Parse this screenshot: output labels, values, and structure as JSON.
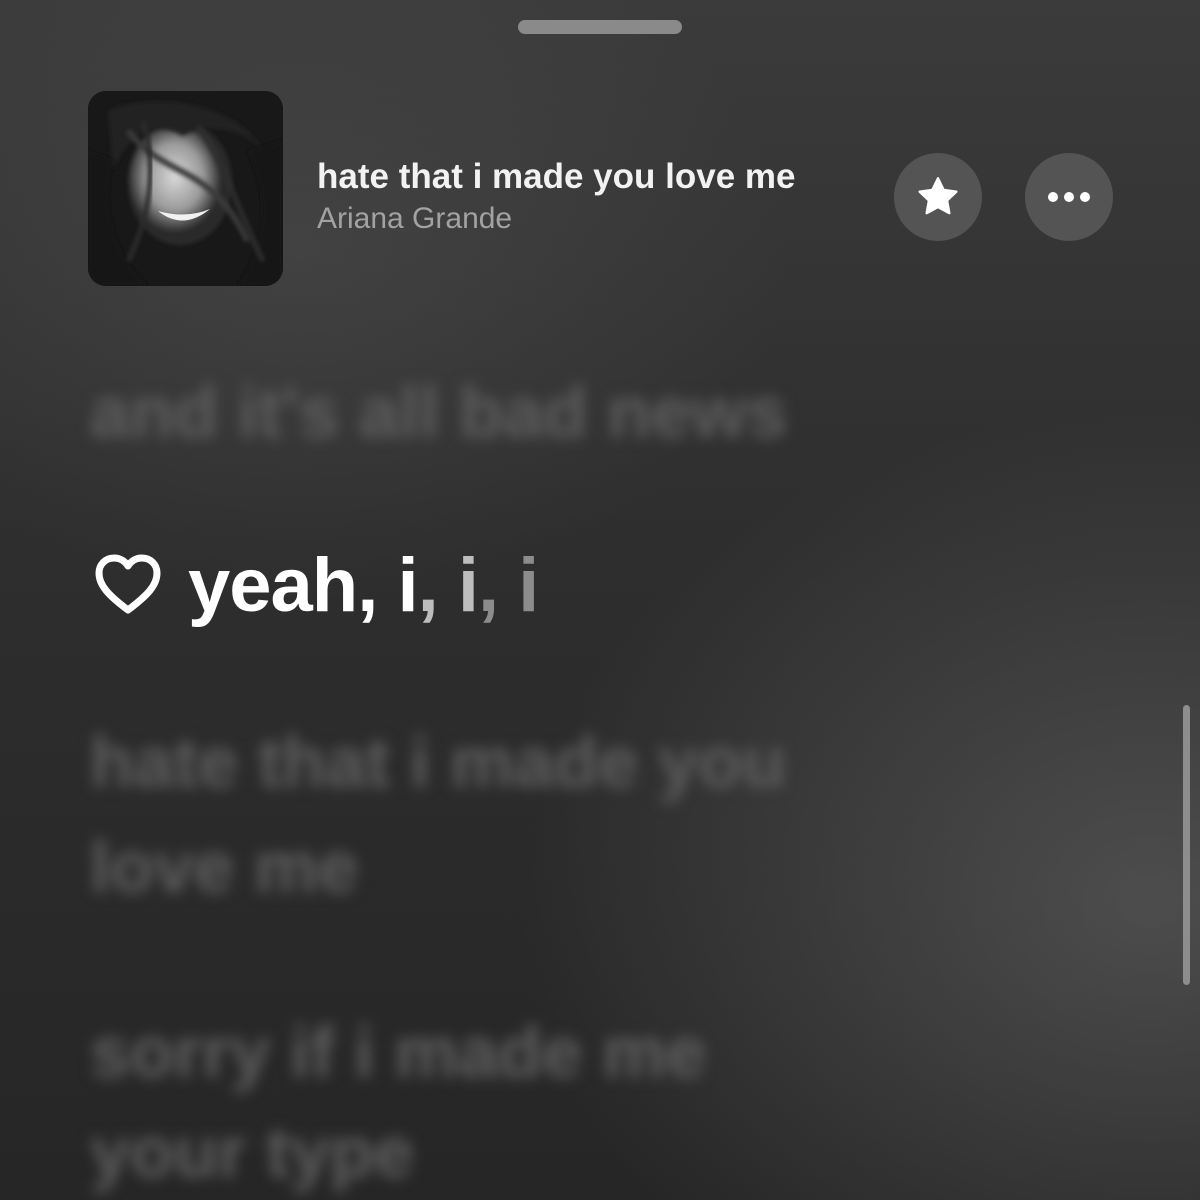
{
  "now_playing": {
    "title": "hate that i made you love me",
    "artist": "Ariana Grande"
  },
  "actions": {
    "favorite_icon": "star-icon",
    "more_icon": "ellipsis-icon"
  },
  "lyrics": {
    "previous_line": "and it's all bad news",
    "current_line": {
      "icon": "heart-icon",
      "segments": [
        "yeah, i",
        ",",
        " i",
        ", i"
      ]
    },
    "next_line_1": "hate that i made you",
    "next_line_2": "love me",
    "next_line_3": "sorry if i made me",
    "next_line_4": "your type"
  }
}
